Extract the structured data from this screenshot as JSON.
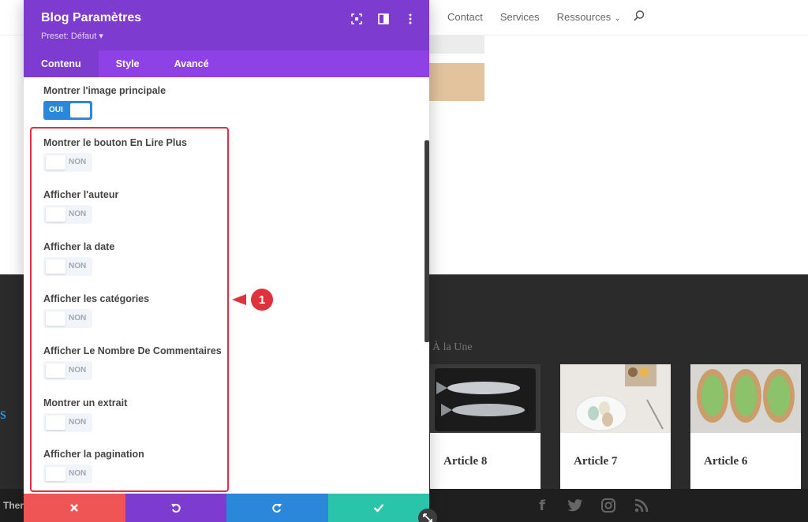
{
  "site": {
    "nav": [
      "Contact",
      "Services",
      "Ressources"
    ],
    "section_label": "À la Une",
    "footer_left": "Ther",
    "side_letter": "s",
    "articles": [
      "Article 8",
      "Article 7",
      "Article 6"
    ]
  },
  "modal": {
    "title": "Blog Paramètres",
    "preset": "Preset: Défaut ▾",
    "tabs": [
      "Contenu",
      "Style",
      "Avancé"
    ],
    "active_tab": "Contenu",
    "fields": [
      {
        "label": "Montrer l'image principale",
        "value": "OUI"
      },
      {
        "label": "Montrer le bouton En Lire Plus",
        "value": "NON"
      },
      {
        "label": "Afficher l'auteur",
        "value": "NON"
      },
      {
        "label": "Afficher la date",
        "value": "NON"
      },
      {
        "label": "Afficher les catégories",
        "value": "NON"
      },
      {
        "label": "Afficher Le Nombre De Commentaires",
        "value": "NON"
      },
      {
        "label": "Montrer un extrait",
        "value": "NON"
      },
      {
        "label": "Afficher la pagination",
        "value": "NON"
      }
    ],
    "callout_number": "1"
  },
  "colors": {
    "header": "#7e3bd0",
    "tabs": "#8e42e6",
    "toggle_on": "#2b87da",
    "highlight": "#e0323c",
    "cancel": "#ef5555",
    "undo": "#7e3bd0",
    "redo": "#2b87da",
    "save": "#29c4a9"
  }
}
